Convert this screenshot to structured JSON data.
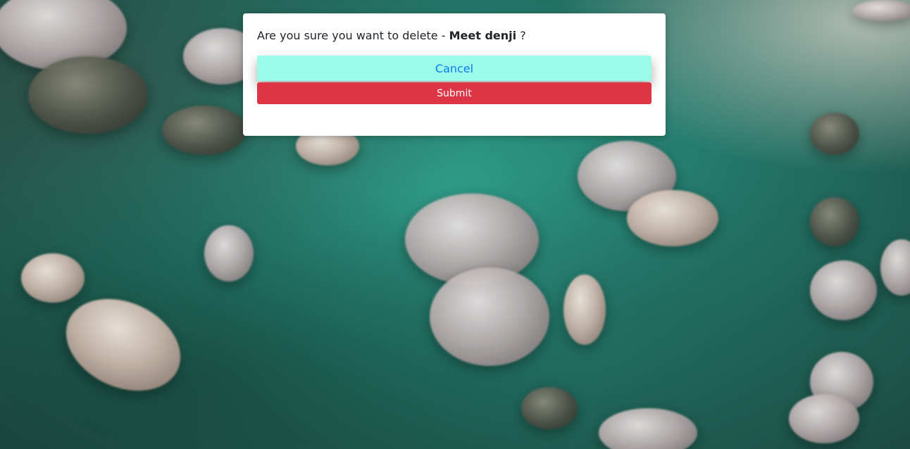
{
  "dialog": {
    "message_prefix": "Are you sure you want to delete - ",
    "item_name": "Meet denji",
    "message_suffix": " ?",
    "cancel_label": "Cancel",
    "submit_label": "Submit"
  },
  "colors": {
    "cancel_bg": "#9bfbe8",
    "cancel_text": "#0b7df0",
    "submit_bg": "#dc3545",
    "submit_text": "#ffffff",
    "modal_bg": "#ffffff",
    "background_water": "#237a6b"
  }
}
